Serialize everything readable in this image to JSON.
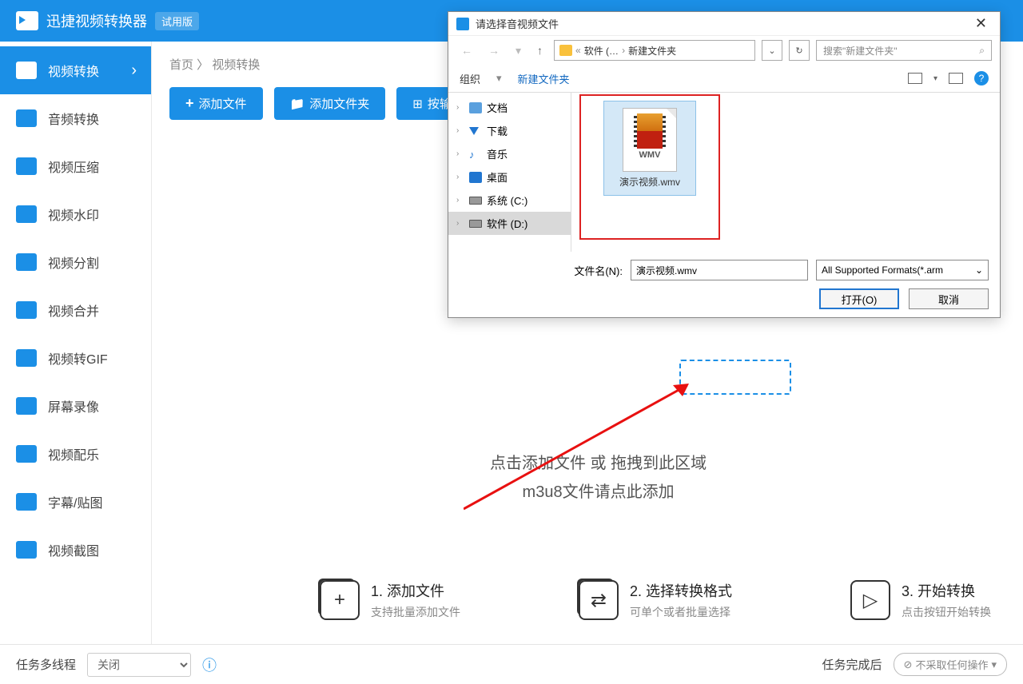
{
  "app": {
    "title": "迅捷视频转换器",
    "badge": "试用版"
  },
  "sidebar": {
    "items": [
      {
        "label": "视频转换"
      },
      {
        "label": "音频转换"
      },
      {
        "label": "视频压缩"
      },
      {
        "label": "视频水印"
      },
      {
        "label": "视频分割"
      },
      {
        "label": "视频合并"
      },
      {
        "label": "视频转GIF"
      },
      {
        "label": "屏幕录像"
      },
      {
        "label": "视频配乐"
      },
      {
        "label": "字幕/贴图"
      },
      {
        "label": "视频截图"
      }
    ]
  },
  "breadcrumb": {
    "home": "首页",
    "current": "视频转换",
    "sep": " 〉 "
  },
  "toolbar": {
    "add_file": "添加文件",
    "add_folder": "添加文件夹",
    "by_output": "按输出批"
  },
  "drop": {
    "line1": "点击添加文件 或 拖拽到此区域",
    "line2": "m3u8文件请点此添加"
  },
  "steps": [
    {
      "title": "1. 添加文件",
      "desc": "支持批量添加文件"
    },
    {
      "title": "2. 选择转换格式",
      "desc": "可单个或者批量选择"
    },
    {
      "title": "3. 开始转换",
      "desc": "点击按钮开始转换"
    }
  ],
  "footer": {
    "threads_label": "任务多线程",
    "threads_value": "关闭",
    "after_label": "任务完成后",
    "after_value": "不采取任何操作"
  },
  "dialog": {
    "title": "请选择音视频文件",
    "path": {
      "seg1": "软件 (…",
      "seg2": "新建文件夹"
    },
    "search_placeholder": "搜索\"新建文件夹\"",
    "organize": "组织",
    "new_folder": "新建文件夹",
    "tree": [
      {
        "label": "文档"
      },
      {
        "label": "下载"
      },
      {
        "label": "音乐"
      },
      {
        "label": "桌面"
      },
      {
        "label": "系统 (C:)"
      },
      {
        "label": "软件 (D:)"
      }
    ],
    "file": {
      "wmv": "WMV",
      "name": "演示视频.wmv"
    },
    "fn_label": "文件名(N):",
    "fn_value": "演示视频.wmv",
    "filter": "All Supported Formats(*.arm",
    "open": "打开(O)",
    "cancel": "取消"
  }
}
